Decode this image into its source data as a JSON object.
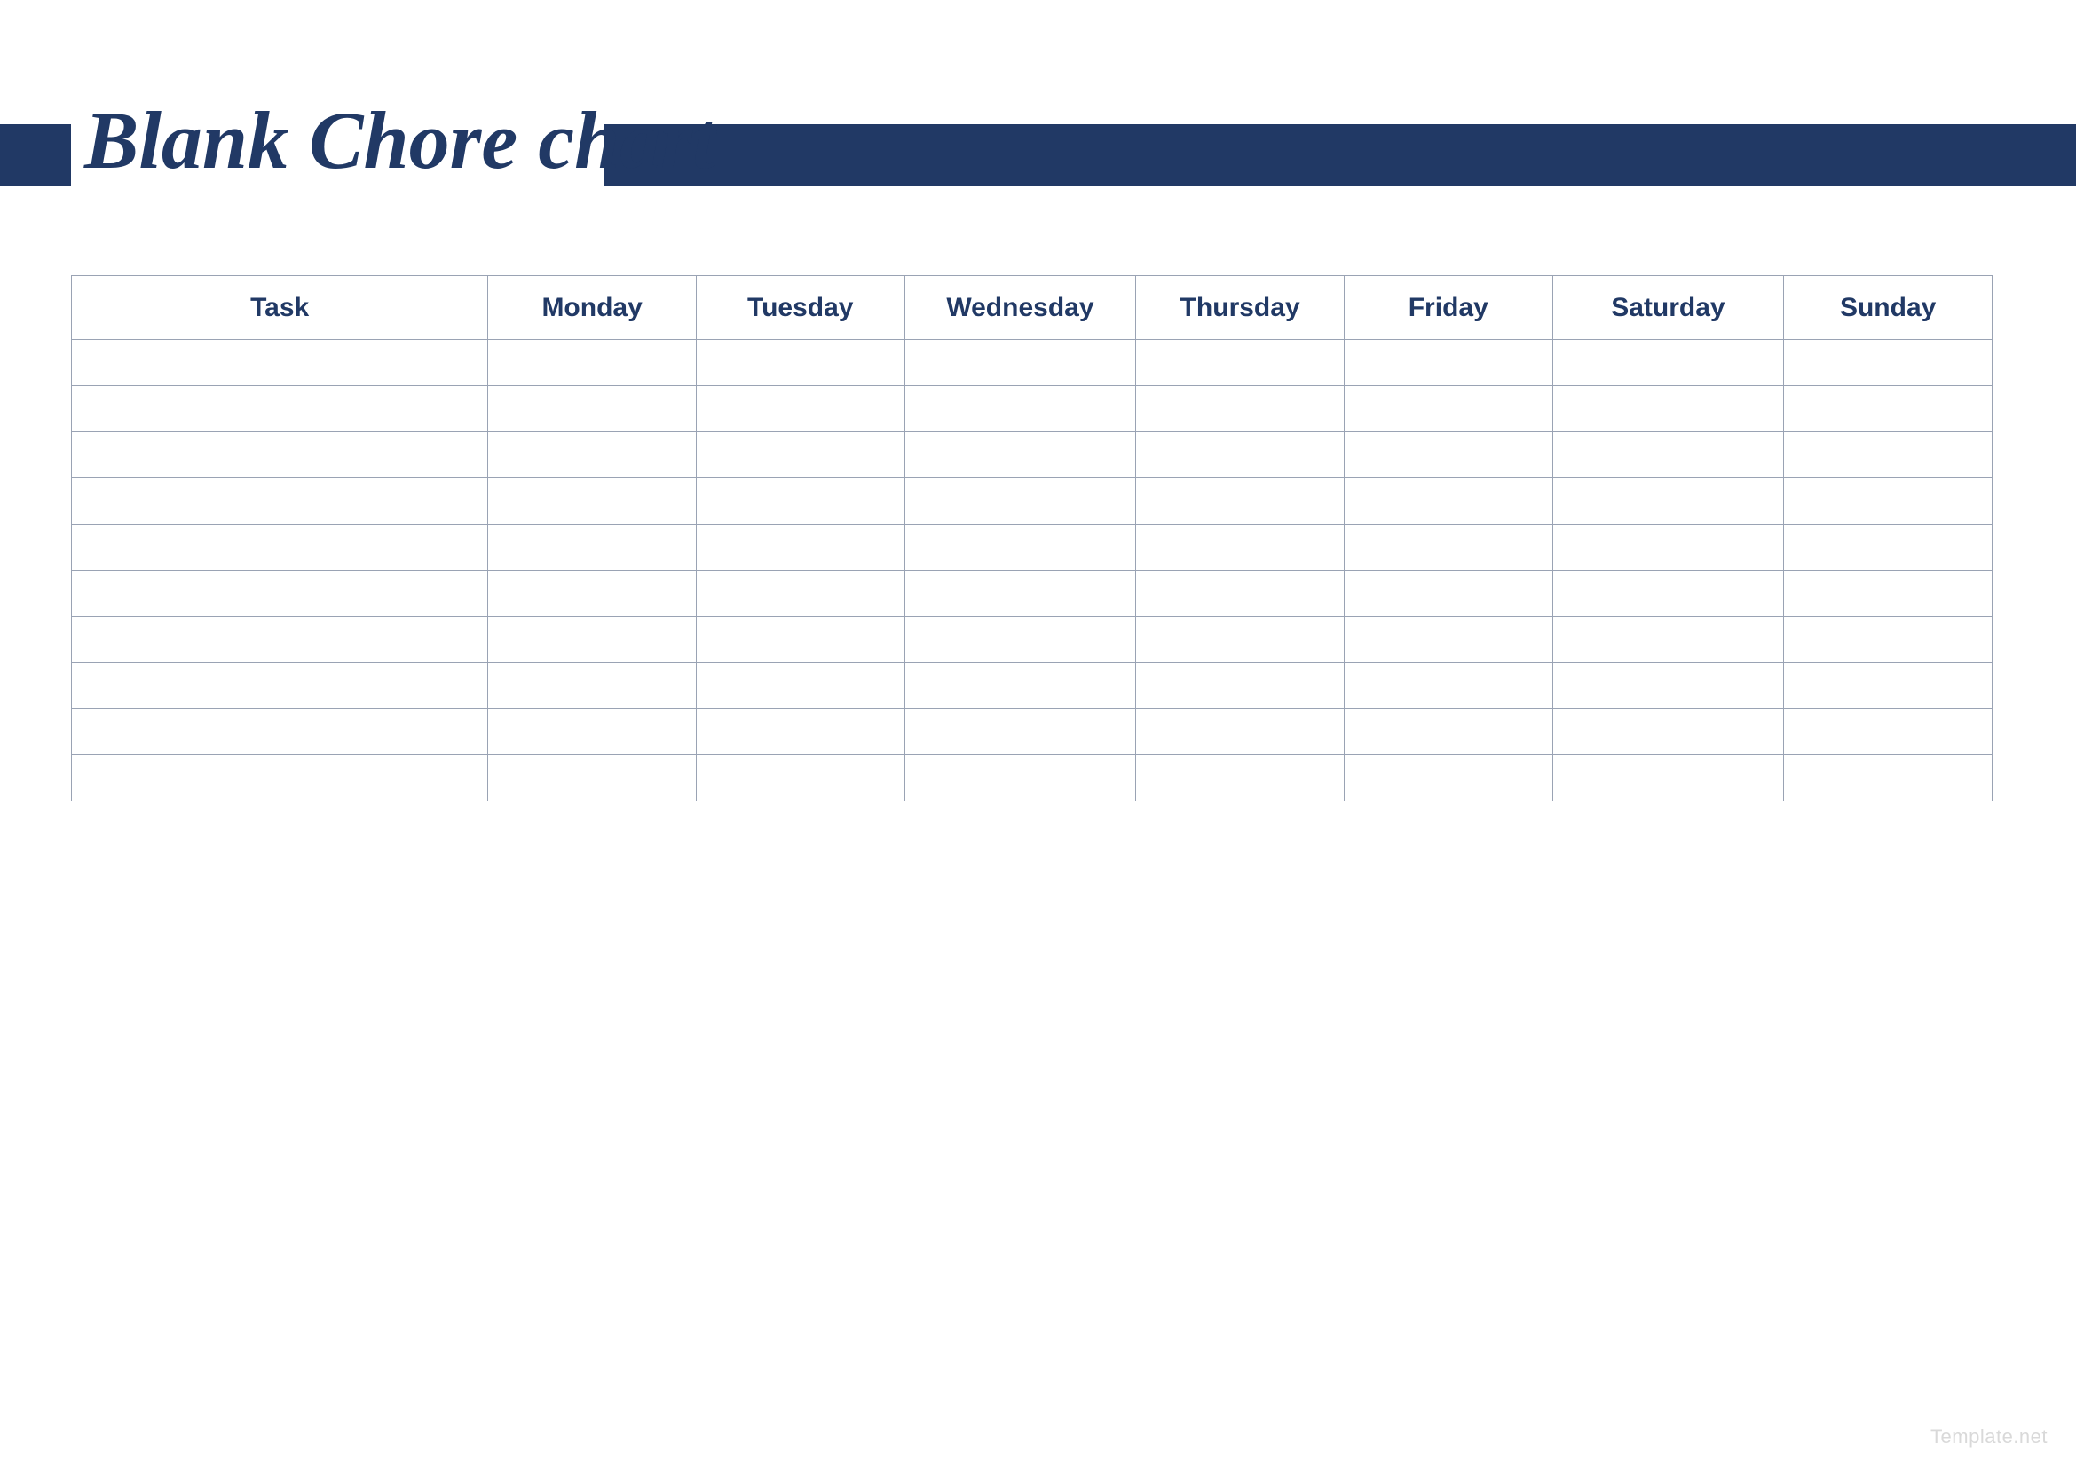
{
  "colors": {
    "brand_navy": "#213965",
    "grid_line": "#9aa3b4",
    "watermark": "#d9d9d9"
  },
  "title": "Blank Chore chart",
  "watermark": "Template.net",
  "chart_data": {
    "type": "table",
    "title": "Blank Chore chart",
    "headers": [
      "Task",
      "Monday",
      "Tuesday",
      "Wednesday",
      "Thursday",
      "Friday",
      "Saturday",
      "Sunday"
    ],
    "rows": [
      [
        "",
        "",
        "",
        "",
        "",
        "",
        "",
        ""
      ],
      [
        "",
        "",
        "",
        "",
        "",
        "",
        "",
        ""
      ],
      [
        "",
        "",
        "",
        "",
        "",
        "",
        "",
        ""
      ],
      [
        "",
        "",
        "",
        "",
        "",
        "",
        "",
        ""
      ],
      [
        "",
        "",
        "",
        "",
        "",
        "",
        "",
        ""
      ],
      [
        "",
        "",
        "",
        "",
        "",
        "",
        "",
        ""
      ],
      [
        "",
        "",
        "",
        "",
        "",
        "",
        "",
        ""
      ],
      [
        "",
        "",
        "",
        "",
        "",
        "",
        "",
        ""
      ],
      [
        "",
        "",
        "",
        "",
        "",
        "",
        "",
        ""
      ],
      [
        "",
        "",
        "",
        "",
        "",
        "",
        "",
        ""
      ]
    ]
  }
}
